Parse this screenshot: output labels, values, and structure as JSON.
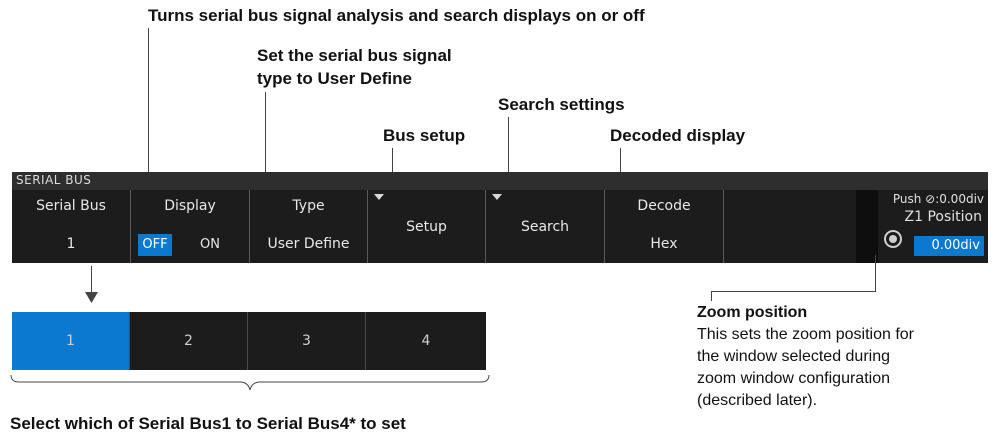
{
  "callouts": {
    "display": "Turns serial bus signal analysis and search displays on or off",
    "type_line1": "Set the serial bus signal",
    "type_line2": "type to User Define",
    "search": "Search settings",
    "bus_setup": "Bus setup",
    "decode": "Decoded display",
    "bottom": "Select which of Serial Bus1 to Serial Bus4* to set"
  },
  "menu": {
    "title": "SERIAL BUS",
    "serial_bus": {
      "label": "Serial Bus",
      "value": "1"
    },
    "display": {
      "label": "Display",
      "off": "OFF",
      "on": "ON",
      "selected": "OFF"
    },
    "type": {
      "label": "Type",
      "value": "User Define"
    },
    "setup": {
      "label": "Setup"
    },
    "search": {
      "label": "Search"
    },
    "decode": {
      "label": "Decode",
      "value": "Hex"
    },
    "zoom": {
      "push": "Push ⊘:0.00div",
      "label": "Z1 Position",
      "value": "0.00div"
    }
  },
  "selector": {
    "items": [
      "1",
      "2",
      "3",
      "4"
    ],
    "selected": "1"
  },
  "zoom_desc": {
    "title": "Zoom position",
    "lines": [
      "This sets the zoom position for",
      "the window selected during",
      "zoom window configuration",
      "(described later)."
    ]
  },
  "colors": {
    "accent": "#0b79d0",
    "panel": "#1c1c1c"
  }
}
